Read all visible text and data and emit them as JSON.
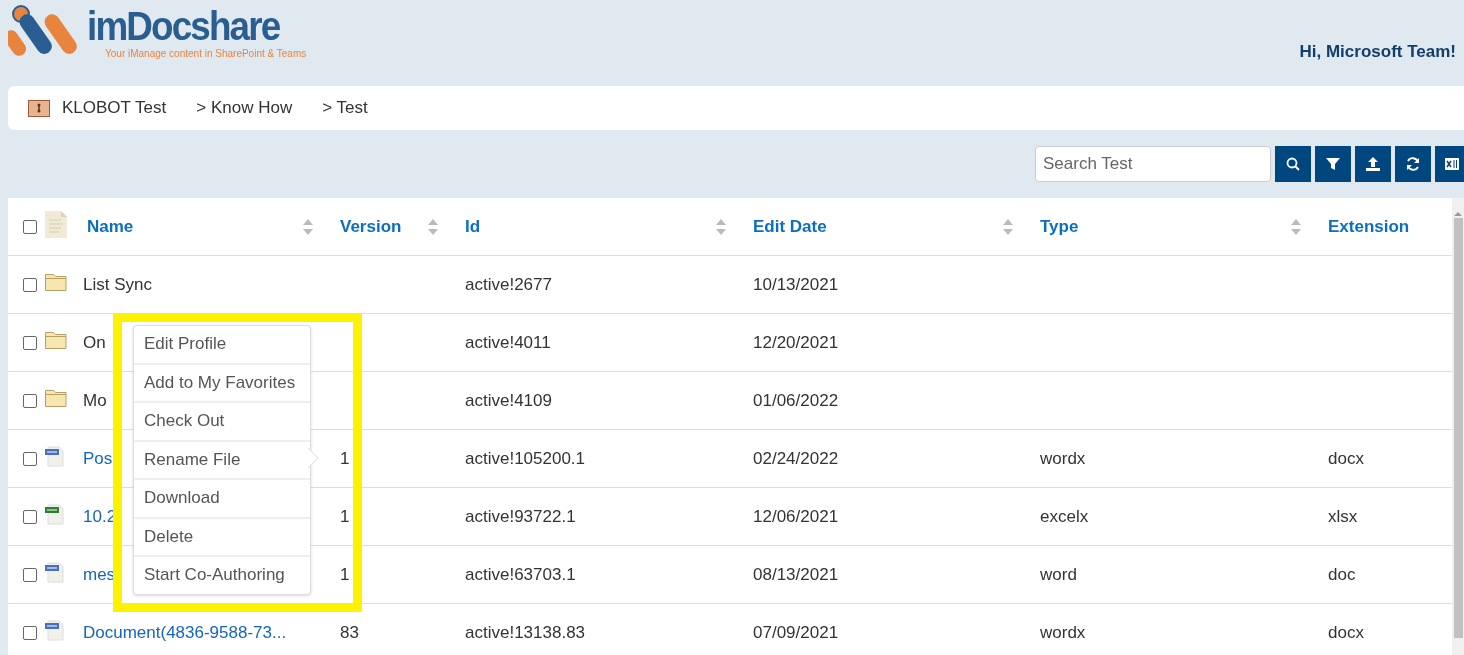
{
  "logo": {
    "name": "imDocshare",
    "tagline": "Your iManage content in SharePoint & Teams"
  },
  "user": {
    "greeting": "Hi, Microsoft Team!"
  },
  "breadcrumb": [
    "KLOBOT Test",
    "> Know How",
    "> Test"
  ],
  "search": {
    "placeholder": "Search Test"
  },
  "table": {
    "select_all": {
      "checked": false
    },
    "columns": [
      "Name",
      "Version",
      "Id",
      "Edit Date",
      "Type",
      "Extension"
    ],
    "rows": [
      {
        "kind": "folder",
        "checked": false,
        "cells": [
          "List Sync",
          "",
          "active!2677",
          "10/13/2021",
          "",
          ""
        ]
      },
      {
        "kind": "folder",
        "checked": false,
        "cells": [
          "On",
          "",
          "active!4011",
          "12/20/2021",
          "",
          ""
        ]
      },
      {
        "kind": "folder",
        "checked": false,
        "cells": [
          "Mo",
          "",
          "active!4109",
          "01/06/2022",
          "",
          ""
        ]
      },
      {
        "kind": "doc",
        "checked": false,
        "cells": [
          "Pos",
          "1",
          "active!105200.1",
          "02/24/2022",
          "wordx",
          "docx"
        ]
      },
      {
        "kind": "xls",
        "checked": false,
        "cells": [
          "10.2",
          "1",
          "active!93722.1",
          "12/06/2021",
          "excelx",
          "xlsx"
        ]
      },
      {
        "kind": "doc",
        "checked": false,
        "cells": [
          "mes",
          "1",
          "active!63703.1",
          "08/13/2021",
          "word",
          "doc"
        ]
      },
      {
        "kind": "doc",
        "checked": false,
        "cells": [
          "Document(4836-9588-73...",
          "83",
          "active!13138.83",
          "07/09/2021",
          "wordx",
          "docx"
        ]
      }
    ]
  },
  "context_menu": [
    "Edit Profile",
    "Add to My Favorites",
    "Check Out",
    "Rename File",
    "Download",
    "Delete",
    "Start Co-Authoring"
  ]
}
